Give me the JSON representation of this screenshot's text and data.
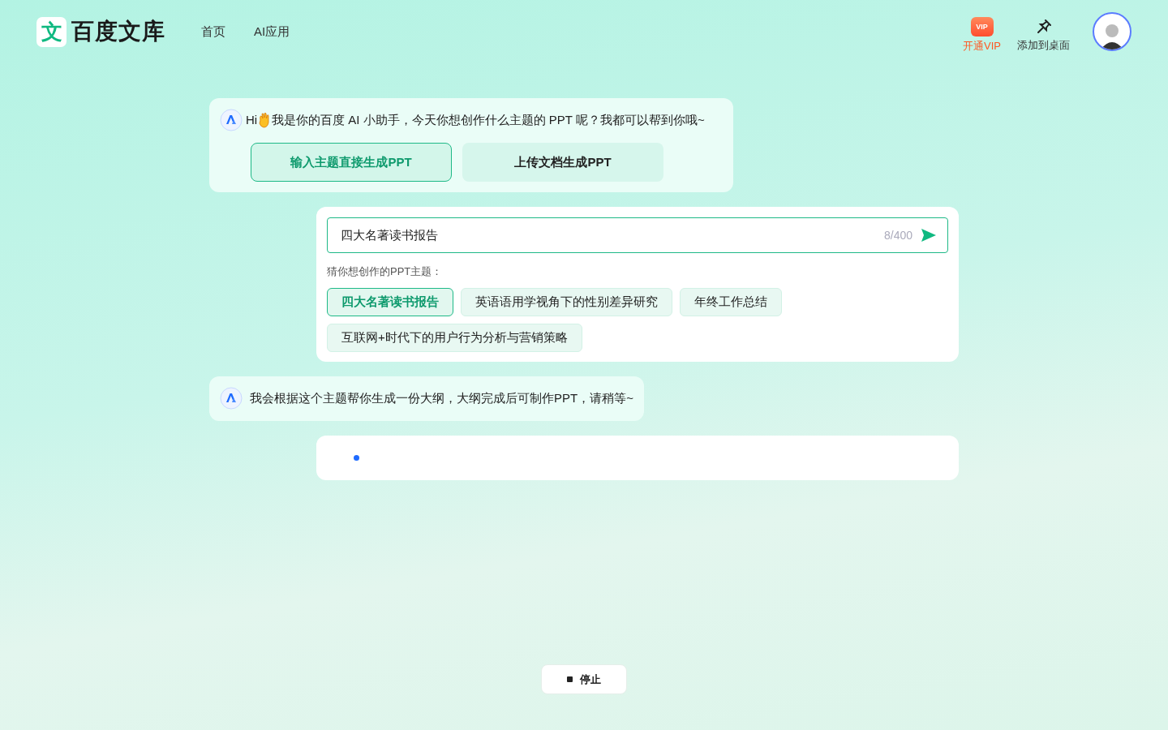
{
  "header": {
    "logo_text": "百度文库",
    "logo_glyph": "文",
    "nav": [
      {
        "label": "首页"
      },
      {
        "label": "AI应用"
      }
    ],
    "actions": [
      {
        "kind": "vip",
        "label": "开通VIP",
        "badge": "VIP"
      },
      {
        "kind": "pin",
        "label": "添加到桌面"
      }
    ]
  },
  "greeting": {
    "prefix": "Hi",
    "text": "我是你的百度 AI 小助手，今天你想创作什么主题的 PPT 呢？我都可以帮到你哦~",
    "modes": [
      {
        "label": "输入主题直接生成PPT",
        "selected": true
      },
      {
        "label": "上传文档生成PPT",
        "selected": false
      }
    ]
  },
  "input": {
    "value": "四大名著读书报告",
    "counter": "8/400",
    "suggest_label": "猜你想创作的PPT主题：",
    "suggestions": [
      {
        "label": "四大名著读书报告",
        "selected": true
      },
      {
        "label": "英语语用学视角下的性别差异研究",
        "selected": false
      },
      {
        "label": "年终工作总结",
        "selected": false
      },
      {
        "label": "互联网+时代下的用户行为分析与营销策略",
        "selected": false
      }
    ]
  },
  "reply": {
    "text": "我会根据这个主题帮你生成一份大纲，大纲完成后可制作PPT，请稍等~"
  },
  "stop_button": {
    "label": "停止"
  }
}
